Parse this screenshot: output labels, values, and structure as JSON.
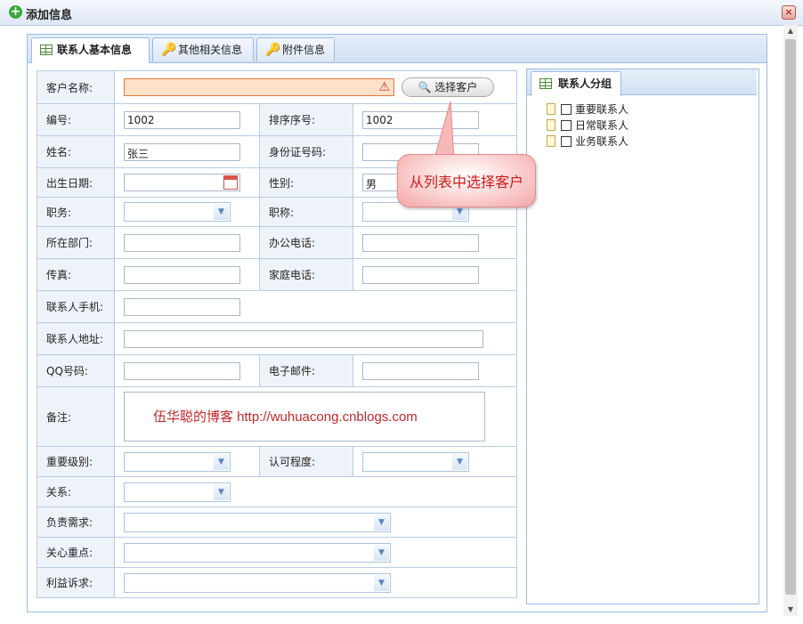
{
  "window": {
    "title": "添加信息"
  },
  "tabs": [
    {
      "label": "联系人基本信息"
    },
    {
      "label": "其他相关信息"
    },
    {
      "label": "附件信息"
    }
  ],
  "form": {
    "customer_name_label": "客户名称:",
    "customer_name_value": "",
    "select_customer_button": "选择客户",
    "code_label": "编号:",
    "code_value": "1002",
    "sort_label": "排序序号:",
    "sort_value": "1002",
    "name_label": "姓名:",
    "name_value": "张三",
    "id_label": "身份证号码:",
    "id_value": "",
    "birth_label": "出生日期:",
    "birth_value": "",
    "gender_label": "性别:",
    "gender_value": "男",
    "duty_label": "职务:",
    "duty_value": "",
    "title_label": "职称:",
    "title_value": "",
    "dept_label": "所在部门:",
    "dept_value": "",
    "office_phone_label": "办公电话:",
    "office_phone_value": "",
    "fax_label": "传真:",
    "fax_value": "",
    "home_phone_label": "家庭电话:",
    "home_phone_value": "",
    "mobile_label": "联系人手机:",
    "mobile_value": "",
    "address_label": "联系人地址:",
    "address_value": "",
    "qq_label": "QQ号码:",
    "qq_value": "",
    "email_label": "电子邮件:",
    "email_value": "",
    "note_label": "备注:",
    "note_watermark": "伍华聪的博客 http://wuhuacong.cnblogs.com",
    "importance_label": "重要级别:",
    "importance_value": "",
    "recognition_label": "认可程度:",
    "recognition_value": "",
    "relation_label": "关系:",
    "relation_value": "",
    "needs_label": "负责需求:",
    "needs_value": "",
    "focus_label": "关心重点:",
    "focus_value": "",
    "interest_label": "利益诉求:",
    "interest_value": ""
  },
  "group_panel": {
    "tab_label": "联系人分组",
    "items": [
      {
        "label": "重要联系人"
      },
      {
        "label": "日常联系人"
      },
      {
        "label": "业务联系人"
      }
    ]
  },
  "callout": {
    "text": "从列表中选择客户"
  }
}
